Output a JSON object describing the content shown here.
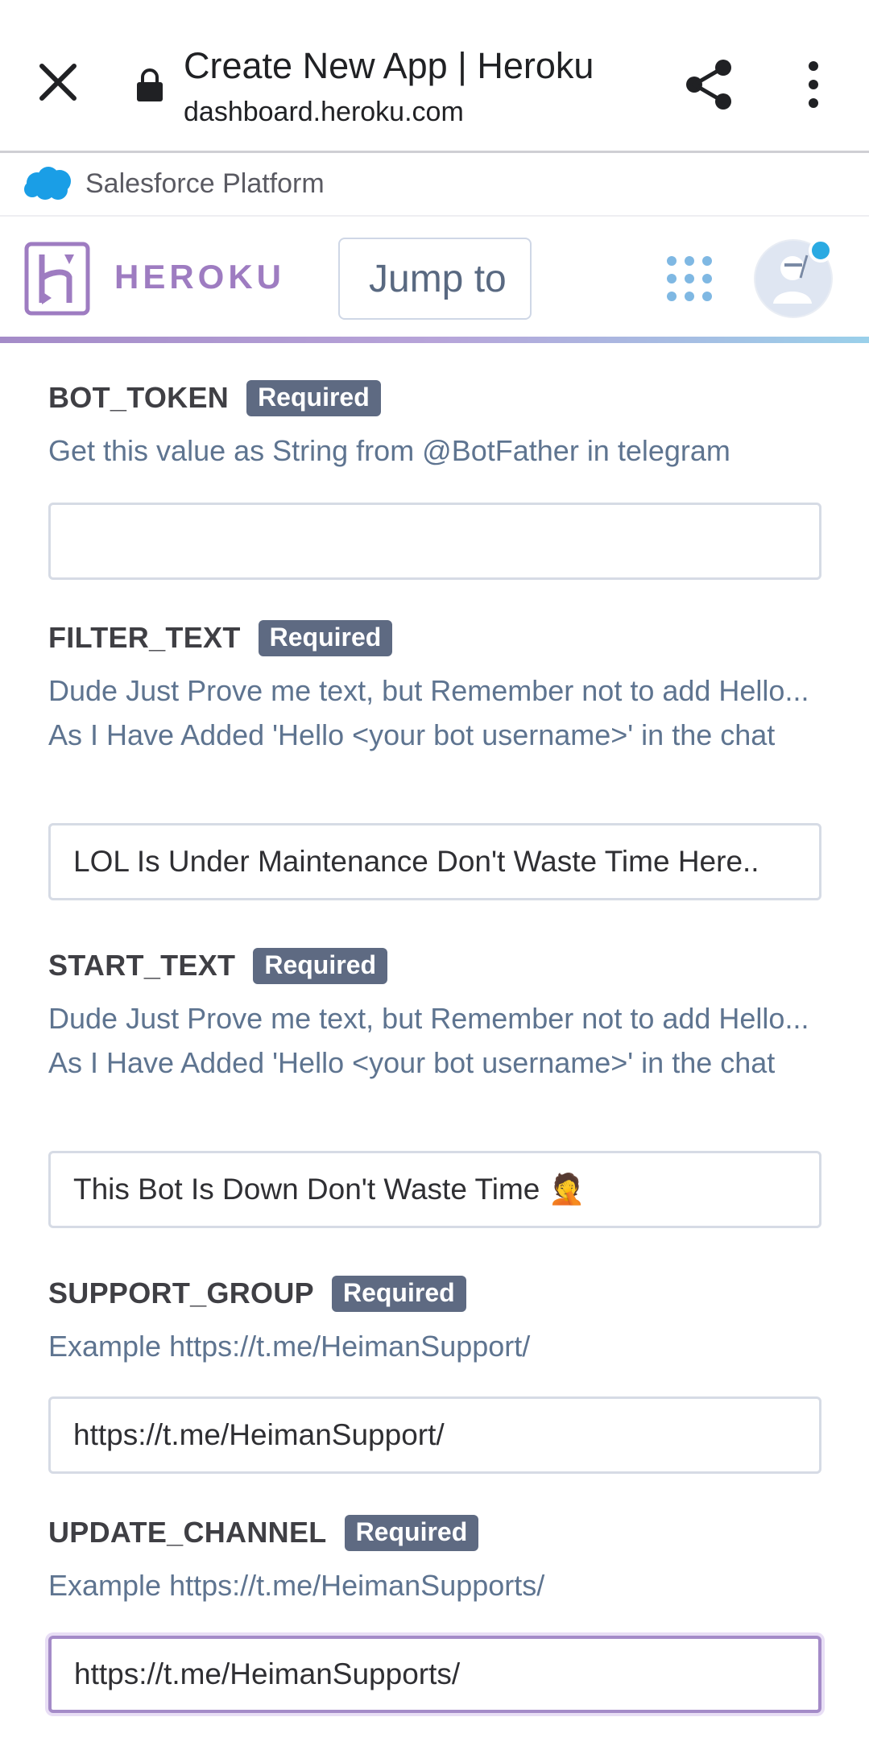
{
  "browser": {
    "page_title": "Create New App | Heroku",
    "url": "dashboard.heroku.com"
  },
  "salesforce": {
    "label": "Salesforce Platform"
  },
  "heroku_header": {
    "wordmark": "HEROKU",
    "search_placeholder": "Jump to"
  },
  "icons": {
    "close": "close-icon",
    "lock": "lock-icon",
    "share": "share-icon",
    "more": "more-vertical-icon",
    "salesforce_cloud": "salesforce-cloud-icon",
    "heroku_logo": "heroku-logo-icon",
    "apps_grid": "apps-grid-icon"
  },
  "colors": {
    "heroku_purple": "#9e7cc1",
    "badge": "#5e6a82",
    "description_text": "#5e7490",
    "focus_border": "#a48bc8",
    "notification_dot": "#2aaae2"
  },
  "fields": [
    {
      "name": "BOT_TOKEN",
      "badge": "Required",
      "description": "Get this value as String from @BotFather in telegram",
      "value": ""
    },
    {
      "name": "FILTER_TEXT",
      "badge": "Required",
      "description": "Dude Just Prove me text, but Remember not to add Hello... As I Have Added 'Hello <your bot username>' in the chat",
      "value": "LOL Is Under Maintenance Don't Waste Time Here.."
    },
    {
      "name": "START_TEXT",
      "badge": "Required",
      "description": "Dude Just Prove me text, but Remember not to add Hello... As I Have Added 'Hello <your bot username>' in the chat",
      "value": "This Bot Is Down Don't Waste Time 🤦"
    },
    {
      "name": "SUPPORT_GROUP",
      "badge": "Required",
      "description": "Example https://t.me/HeimanSupport/",
      "value": "https://t.me/HeimanSupport/"
    },
    {
      "name": "UPDATE_CHANNEL",
      "badge": "Required",
      "description": "Example https://t.me/HeimanSupports/",
      "value": "https://t.me/HeimanSupports/"
    }
  ]
}
